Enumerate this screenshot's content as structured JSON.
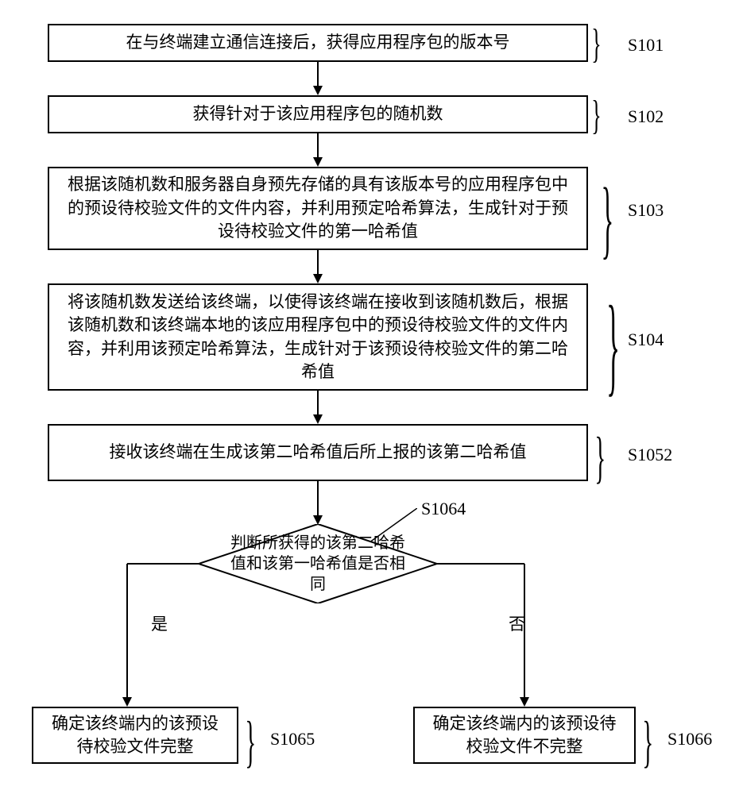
{
  "steps": {
    "s101": {
      "text": "在与终端建立通信连接后，获得应用程序包的版本号",
      "label": "S101"
    },
    "s102": {
      "text": "获得针对于该应用程序包的随机数",
      "label": "S102"
    },
    "s103": {
      "text": "根据该随机数和服务器自身预先存储的具有该版本号的应用程序包中的预设待校验文件的文件内容，并利用预定哈希算法，生成针对于预设待校验文件的第一哈希值",
      "label": "S103"
    },
    "s104": {
      "text": "将该随机数发送给该终端，以使得该终端在接收到该随机数后，根据该随机数和该终端本地的该应用程序包中的预设待校验文件的文件内容，并利用该预定哈希算法，生成针对于该预设待校验文件的第二哈希值",
      "label": "S104"
    },
    "s1052": {
      "text": "接收该终端在生成该第二哈希值后所上报的该第二哈希值",
      "label": "S1052"
    },
    "s1064": {
      "text": "判断所获得的该第二哈希值和该第一哈希值是否相同",
      "label": "S1064"
    },
    "s1065": {
      "text": "确定该终端内的该预设待校验文件完整",
      "label": "S1065"
    },
    "s1066": {
      "text": "确定该终端内的该预设待校验文件不完整",
      "label": "S1066"
    }
  },
  "branches": {
    "yes": "是",
    "no": "否"
  },
  "chart_data": {
    "type": "flowchart",
    "nodes": [
      {
        "id": "S101",
        "shape": "rect",
        "text": "在与终端建立通信连接后，获得应用程序包的版本号"
      },
      {
        "id": "S102",
        "shape": "rect",
        "text": "获得针对于该应用程序包的随机数"
      },
      {
        "id": "S103",
        "shape": "rect",
        "text": "根据该随机数和服务器自身预先存储的具有该版本号的应用程序包中的预设待校验文件的文件内容，并利用预定哈希算法，生成针对于预设待校验文件的第一哈希值"
      },
      {
        "id": "S104",
        "shape": "rect",
        "text": "将该随机数发送给该终端，以使得该终端在接收到该随机数后，根据该随机数和该终端本地的该应用程序包中的预设待校验文件的文件内容，并利用该预定哈希算法，生成针对于该预设待校验文件的第二哈希值"
      },
      {
        "id": "S1052",
        "shape": "rect",
        "text": "接收该终端在生成该第二哈希值后所上报的该第二哈希值"
      },
      {
        "id": "S1064",
        "shape": "diamond",
        "text": "判断所获得的该第二哈希值和该第一哈希值是否相同"
      },
      {
        "id": "S1065",
        "shape": "rect",
        "text": "确定该终端内的该预设待校验文件完整"
      },
      {
        "id": "S1066",
        "shape": "rect",
        "text": "确定该终端内的该预设待校验文件不完整"
      }
    ],
    "edges": [
      {
        "from": "S101",
        "to": "S102"
      },
      {
        "from": "S102",
        "to": "S103"
      },
      {
        "from": "S103",
        "to": "S104"
      },
      {
        "from": "S104",
        "to": "S1052"
      },
      {
        "from": "S1052",
        "to": "S1064"
      },
      {
        "from": "S1064",
        "to": "S1065",
        "label": "是"
      },
      {
        "from": "S1064",
        "to": "S1066",
        "label": "否"
      }
    ]
  }
}
